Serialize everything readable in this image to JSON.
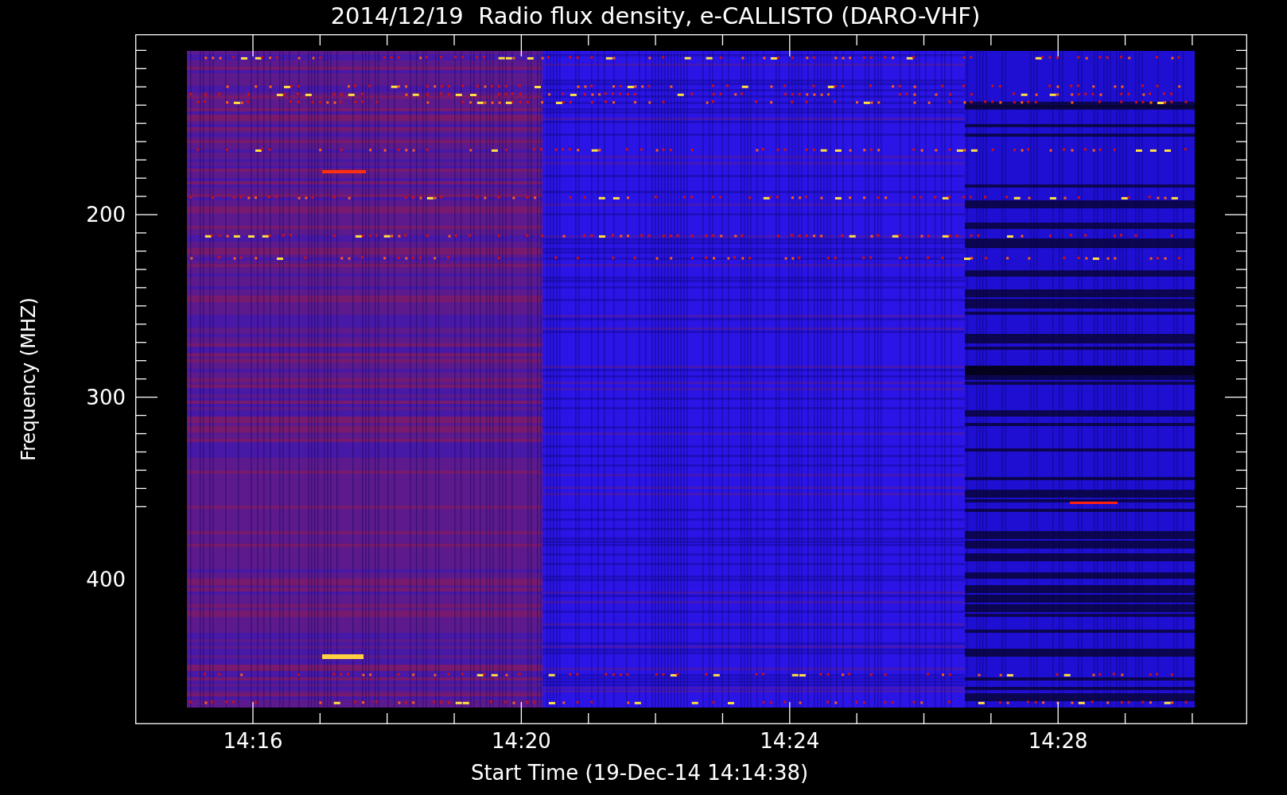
{
  "title": "2014/12/19  Radio flux density, e-CALLISTO (DARO-VHF)",
  "y_axis": {
    "label": "Frequency (MHZ)",
    "ticks": [
      "200",
      "300",
      "400"
    ]
  },
  "x_axis": {
    "label": "Start Time (19-Dec-14 14:14:38)",
    "ticks": [
      "14:16",
      "14:20",
      "14:24",
      "14:28"
    ]
  }
}
